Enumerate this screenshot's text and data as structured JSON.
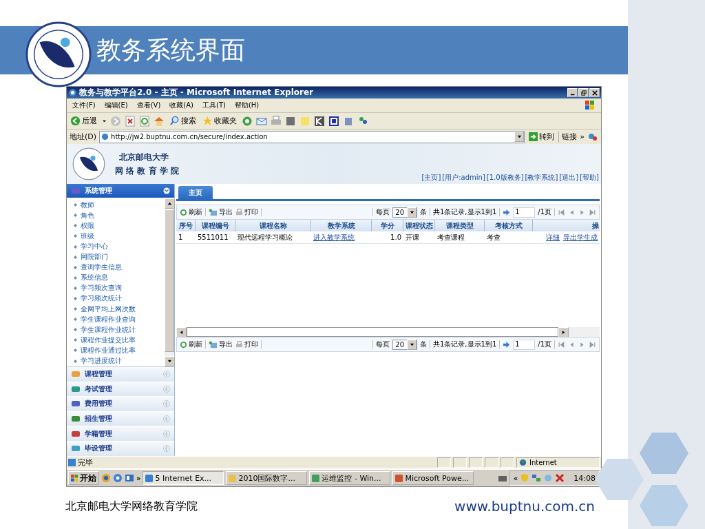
{
  "slide": {
    "title": "教务系统界面",
    "footer_left": "北京邮电大学网络教育学院",
    "footer_right": "www.buptnu.com.cn"
  },
  "window": {
    "title": "教务与教学平台2.0 - 主页 - Microsoft Internet Explorer"
  },
  "menu": [
    "文件(F)",
    "编辑(E)",
    "查看(V)",
    "收藏(A)",
    "工具(T)",
    "帮助(H)"
  ],
  "toolbar": {
    "back": "后退",
    "search": "搜索",
    "favorites": "收藏夹"
  },
  "address": {
    "label": "地址(D)",
    "value": "http://jw2.buptnu.com.cn/secure/index.action",
    "go": "转到",
    "links": "链接",
    "more": "»"
  },
  "banner": {
    "line1": "北京邮电大学",
    "line2": "网 络 教 育 学 院",
    "links": [
      "[主页]",
      "[用户:admin]",
      "[1.0版教务]",
      "[教学系统]",
      "[退出]",
      "[帮助]"
    ]
  },
  "sidebar": {
    "sections": [
      {
        "label": "系统管理",
        "expanded": true,
        "items": [
          "教师",
          "角色",
          "权限",
          "班级",
          "学习中心",
          "网院部门",
          "查询学生信息",
          "系统信息",
          "学习频次查询",
          "学习频次统计",
          "全网平均上网次数",
          "学生课程作业查询",
          "学生课程作业统计",
          "课程作业提交比率",
          "课程作业通过比率",
          "学习进度统计"
        ]
      },
      {
        "label": "课程管理",
        "expanded": false
      },
      {
        "label": "考试管理",
        "expanded": false
      },
      {
        "label": "费用管理",
        "expanded": false
      },
      {
        "label": "招生管理",
        "expanded": false
      },
      {
        "label": "学籍管理",
        "expanded": false
      },
      {
        "label": "毕设管理",
        "expanded": false
      }
    ]
  },
  "tabs": [
    {
      "label": "主页",
      "selected": true
    }
  ],
  "pager": {
    "refresh": "刷新",
    "export": "导出",
    "print": "打印",
    "per_page_label": "每页",
    "per_page": "20",
    "per_page_unit": "条",
    "summary": "共1条记录,显示1到1",
    "page": "1",
    "pages": "/1页"
  },
  "table": {
    "columns": [
      "序号",
      "课程编号",
      "课程名称",
      "教学系统",
      "学分",
      "课程状态",
      "课程类型",
      "考核方式",
      "操"
    ],
    "rows": [
      [
        {
          "kind": "text",
          "text": "1"
        },
        {
          "kind": "text",
          "text": "5511011"
        },
        {
          "kind": "text",
          "text": "现代远程学习概论"
        },
        {
          "kind": "link",
          "text": "进入教学系统"
        },
        {
          "kind": "number",
          "text": "1.0"
        },
        {
          "kind": "text",
          "text": "开课"
        },
        {
          "kind": "text",
          "text": "考查课程"
        },
        {
          "kind": "text",
          "text": "考查"
        },
        {
          "kind": "links",
          "links": [
            "详细",
            "导出学生成"
          ]
        }
      ]
    ]
  },
  "pager_bottom": {
    "refresh": "刷新",
    "export": "导出",
    "print": "打印",
    "per_page_label": "每页",
    "per_page": "20",
    "per_page_unit": "条",
    "summary": "共1条记录,显示1到1",
    "page": "1",
    "pages": "/1页"
  },
  "status_bar": {
    "text": "完毕",
    "zone": "Internet"
  },
  "taskbar": {
    "start": "开始",
    "more": "»",
    "tasks": [
      {
        "label": "5 Internet Ex...",
        "selected": true
      },
      {
        "label": "2010国际数字...",
        "selected": false
      },
      {
        "label": "运维监控 - Win...",
        "selected": false
      },
      {
        "label": "Microsoft Powe...",
        "selected": false
      }
    ],
    "tray_more": "«",
    "clock": "14:08"
  }
}
